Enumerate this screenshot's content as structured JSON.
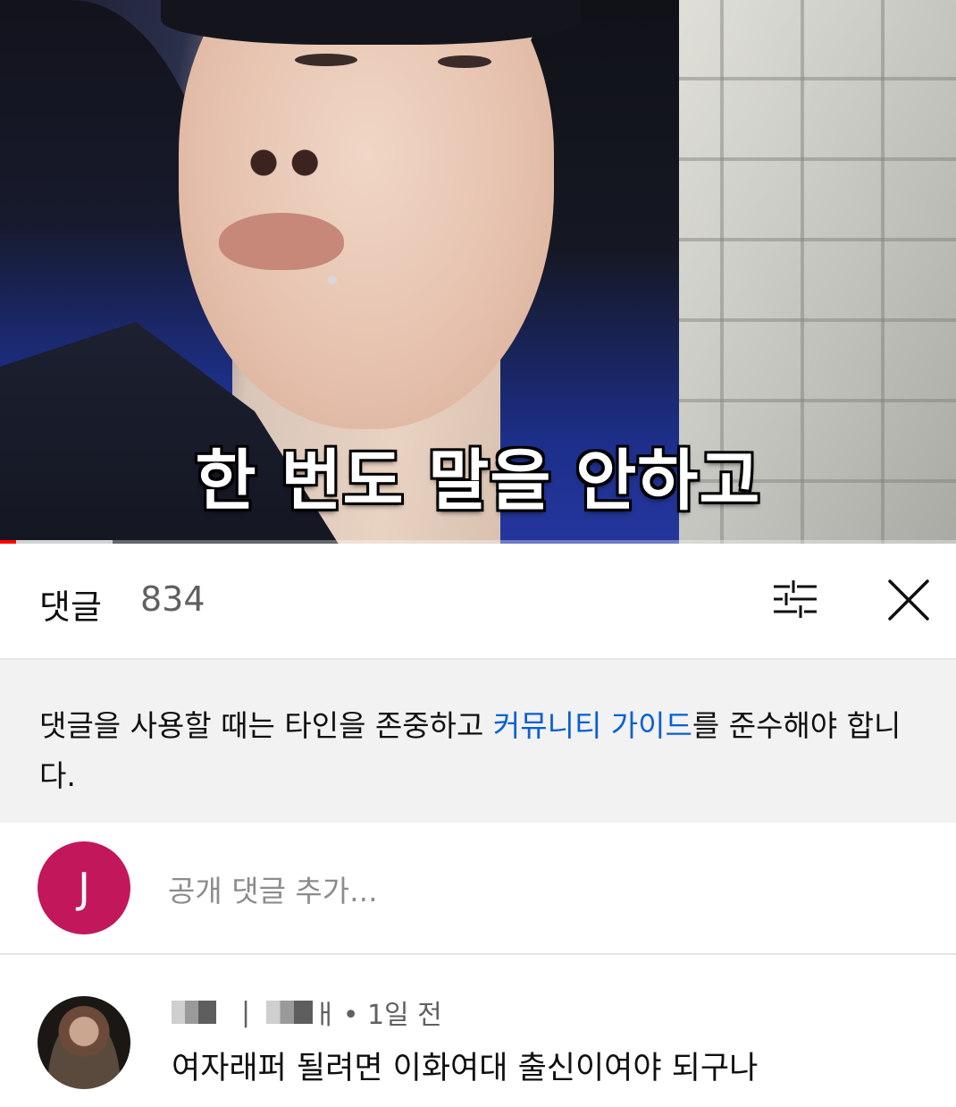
{
  "video": {
    "caption": "한 번도 말을 안하고",
    "progress_fraction": 0.017,
    "buffered_fraction": 0.118
  },
  "comments_header": {
    "title": "댓글",
    "count": "834",
    "sort_icon": "sort-filter-icon",
    "close_icon": "close-icon"
  },
  "notice": {
    "text_before_link": "댓글을 사용할 때는 타인을 존중하고 ",
    "link_text": "커뮤니티 가이드",
    "text_after_link": "를 준수해야 합니다."
  },
  "add_comment": {
    "avatar_letter": "J",
    "avatar_color": "#c2185b",
    "placeholder": "공개 댓글 추가..."
  },
  "comments": [
    {
      "meta_suffix": "ㅐ",
      "time": "• 1일 전",
      "text": "여자래퍼 될려면 이화여대 출신이여야 되구나"
    }
  ],
  "colors": {
    "link": "#065fd4",
    "progress": "#ff0000",
    "notice_bg": "#f2f2f2"
  }
}
